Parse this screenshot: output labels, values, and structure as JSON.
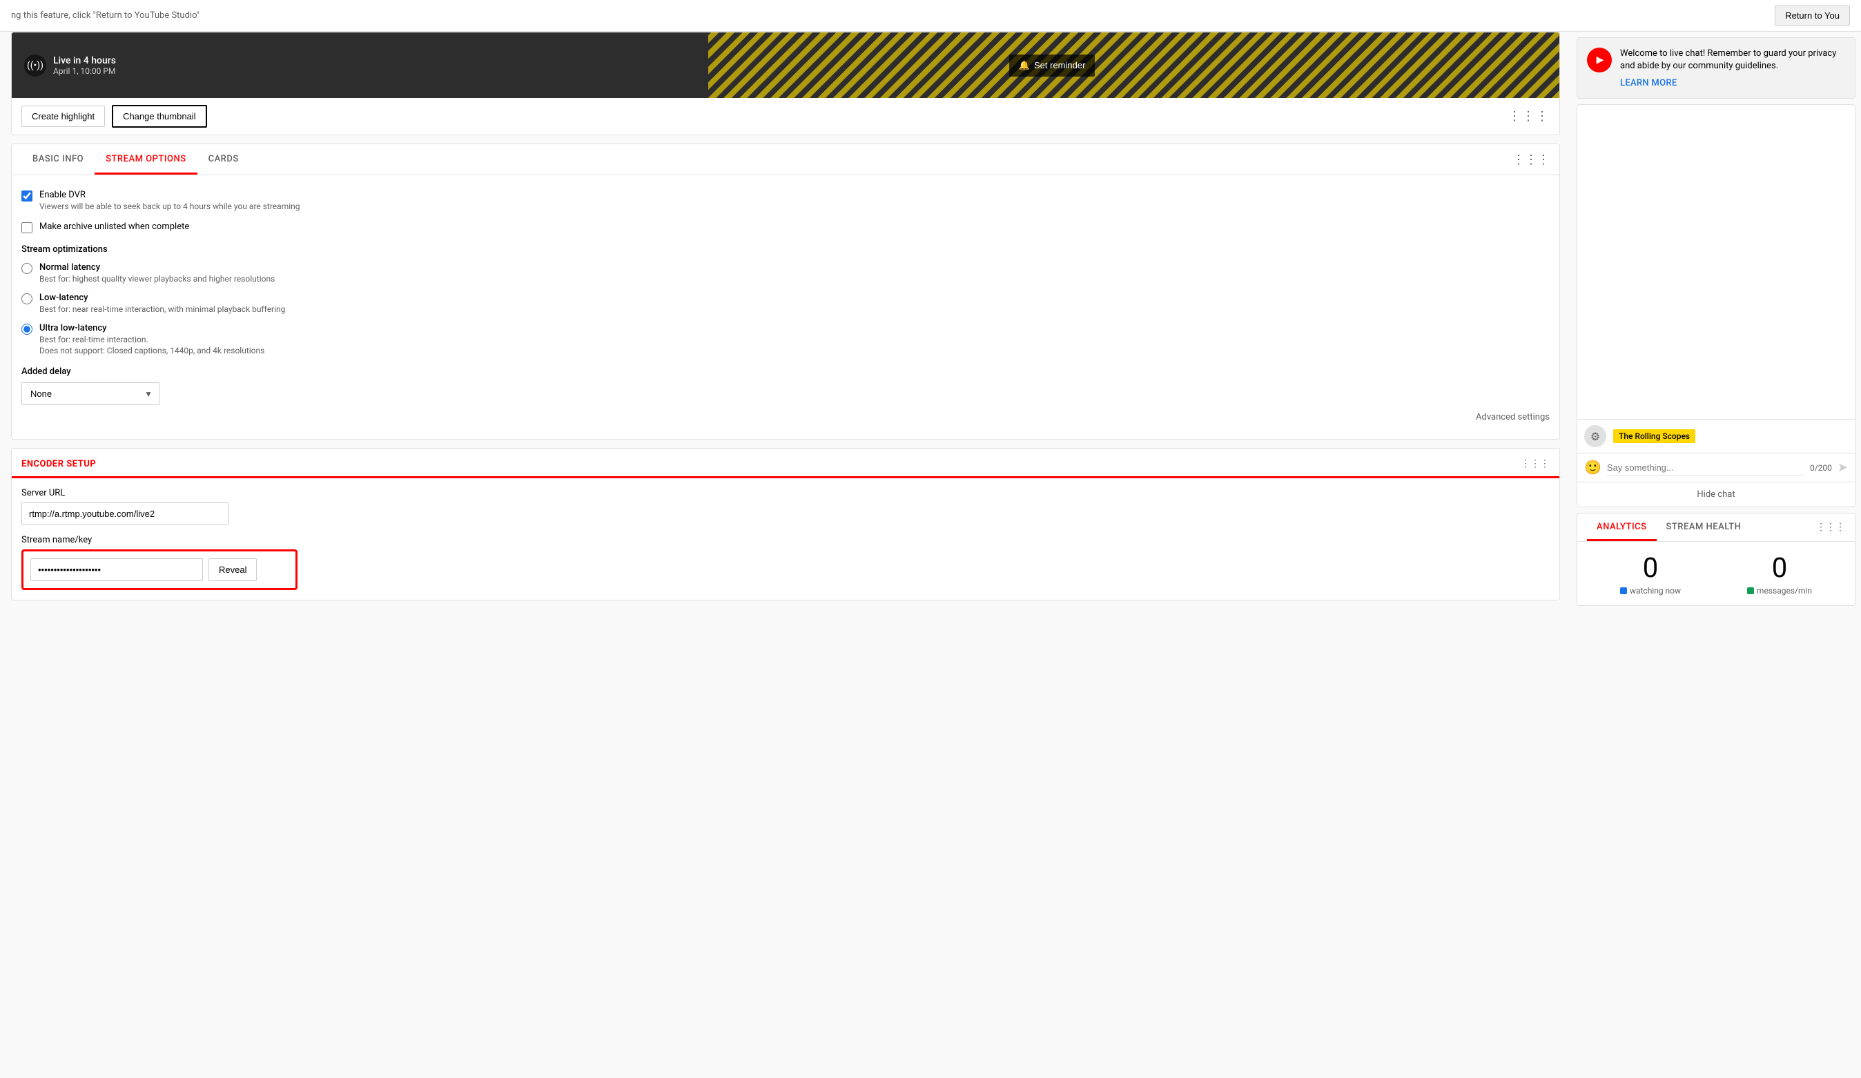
{
  "topbar": {
    "notice_text": "ng this feature, click \"Return to YouTube Studio\"",
    "return_button_label": "Return to You"
  },
  "video_preview": {
    "live_badge": "((•))",
    "live_title": "Live in 4 hours",
    "live_subtitle": "April 1, 10:00 PM",
    "set_reminder_label": "Set reminder",
    "create_highlight_label": "Create highlight",
    "change_thumbnail_label": "Change thumbnail"
  },
  "tabs": {
    "basic_info_label": "BASIC INFO",
    "stream_options_label": "STREAM OPTIONS",
    "cards_label": "CARDS",
    "active_tab": "STREAM OPTIONS"
  },
  "stream_options": {
    "enable_dvr_label": "Enable DVR",
    "enable_dvr_checked": true,
    "enable_dvr_description": "Viewers will be able to seek back up to 4 hours while you are streaming",
    "make_archive_label": "Make archive unlisted when complete",
    "make_archive_checked": false,
    "optimizations_label": "Stream optimizations",
    "normal_latency_label": "Normal latency",
    "normal_latency_desc": "Best for: highest quality viewer playbacks and higher resolutions",
    "low_latency_label": "Low-latency",
    "low_latency_desc": "Best for: near real-time interaction, with minimal playback buffering",
    "ultra_low_latency_label": "Ultra low-latency",
    "ultra_low_latency_desc_1": "Best for: real-time interaction.",
    "ultra_low_latency_desc_2": "Does not support: Closed captions, 1440p, and 4k resolutions",
    "added_delay_label": "Added delay",
    "delay_option_none": "None",
    "advanced_settings_label": "Advanced settings"
  },
  "encoder_setup": {
    "title": "ENCODER SETUP",
    "server_url_label": "Server URL",
    "server_url_value": "rtmp://a.rtmp.youtube.com/live2",
    "stream_key_label": "Stream name/key",
    "stream_key_value": "••••••••••••••••••••",
    "reveal_label": "Reveal"
  },
  "chat": {
    "welcome_text": "Welcome to live chat! Remember to guard your privacy and abide by our community guidelines.",
    "learn_more_label": "LEARN MORE",
    "username": "The Rolling Scopes",
    "input_placeholder": "Say something...",
    "char_count": "0/200",
    "hide_chat_label": "Hide chat"
  },
  "analytics": {
    "analytics_tab_label": "ANALYTICS",
    "stream_health_tab_label": "STREAM HEALTH",
    "watching_now_count": "0",
    "watching_now_label": "watching now",
    "messages_per_min_count": "0",
    "messages_per_min_label": "messages/min"
  }
}
